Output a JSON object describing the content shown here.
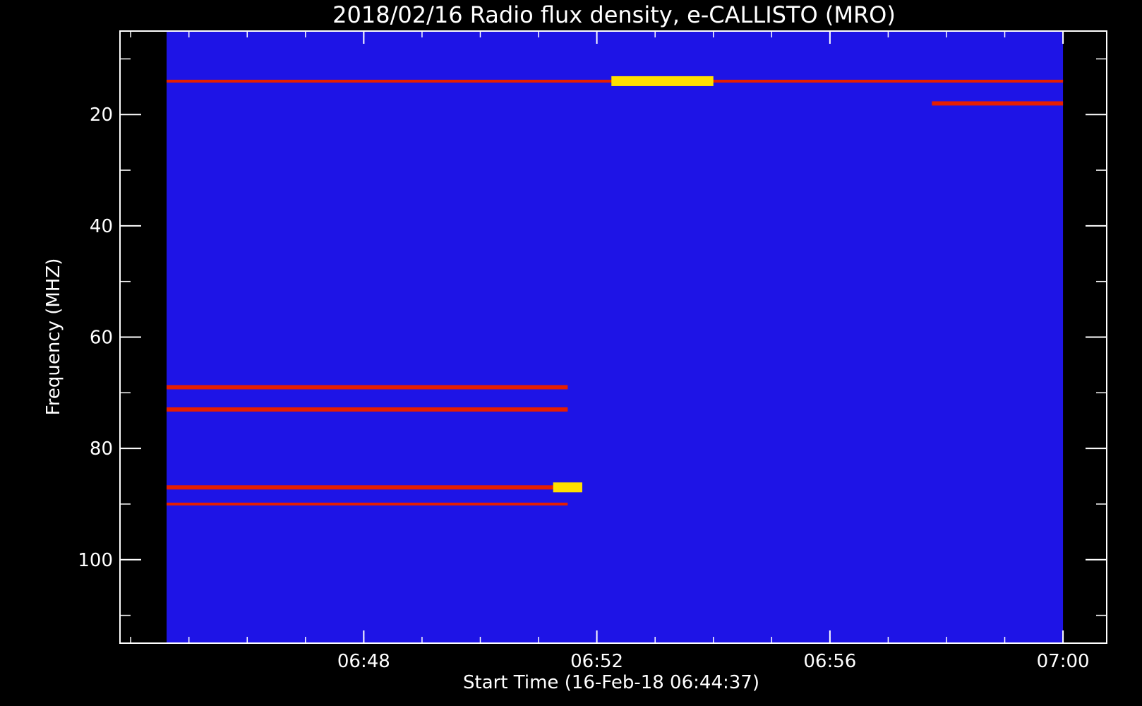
{
  "chart_data": {
    "type": "heatmap",
    "title": "2018/02/16  Radio flux density, e-CALLISTO (MRO)",
    "xlabel": "Start Time (16-Feb-18 06:44:37)",
    "ylabel": "Frequency (MHZ)",
    "x_start": "06:44:37",
    "x_end": "07:00:00",
    "xlim": [
      "06:43:49",
      "07:00:45"
    ],
    "ylim": [
      115,
      5
    ],
    "y_inverted": true,
    "x_ticks": [
      "06:48",
      "06:52",
      "06:56",
      "07:00"
    ],
    "y_ticks": [
      20,
      40,
      60,
      80,
      100
    ],
    "y_range": [
      5,
      115
    ],
    "colormap": [
      "#000000",
      "#1e14e6",
      "#e61e00",
      "#ffe000",
      "#ffffff"
    ],
    "background_color": "#1e14e6",
    "features": [
      {
        "name": "narrowband interference",
        "freq_mhz": 14.0,
        "time_start": "06:44:37",
        "time_end": "07:00:00",
        "level": "medium"
      },
      {
        "name": "narrowband interference",
        "freq_mhz": 69.0,
        "time_start": "06:44:37",
        "time_end": "06:51:30",
        "level": "high"
      },
      {
        "name": "narrowband interference",
        "freq_mhz": 73.0,
        "time_start": "06:44:37",
        "time_end": "06:51:30",
        "level": "high"
      },
      {
        "name": "narrowband interference",
        "freq_mhz": 87.0,
        "time_start": "06:44:37",
        "time_end": "06:51:30",
        "level": "high"
      },
      {
        "name": "narrowband interference",
        "freq_mhz": 90.0,
        "time_start": "06:44:37",
        "time_end": "06:51:30",
        "level": "medium"
      },
      {
        "name": "burst",
        "freq_mhz": 87.0,
        "time_start": "06:51:15",
        "time_end": "06:51:45",
        "level": "saturated"
      },
      {
        "name": "burst",
        "freq_mhz": 18.0,
        "time_start": "06:57:45",
        "time_end": "07:00:00",
        "level": "high"
      },
      {
        "name": "burst",
        "freq_mhz": 14.0,
        "time_start": "06:52:15",
        "time_end": "06:54:00",
        "level": "saturated"
      }
    ]
  }
}
